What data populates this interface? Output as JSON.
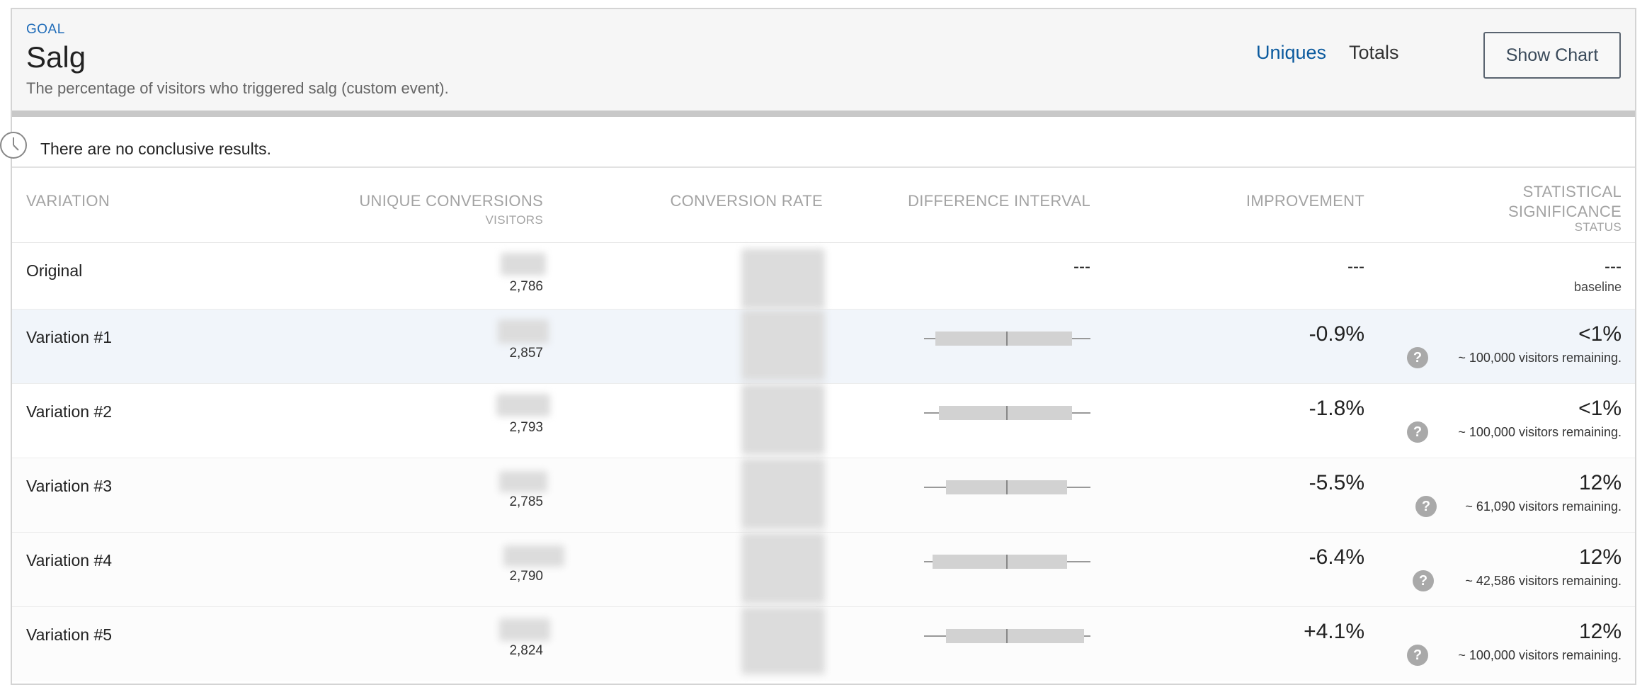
{
  "goal": {
    "label": "GOAL",
    "title": "Salg",
    "description": "The percentage of visitors who triggered salg (custom event)."
  },
  "tabs": {
    "uniques": "Uniques",
    "totals": "Totals",
    "active": "uniques"
  },
  "show_chart_label": "Show Chart",
  "notice": "There are no conclusive results.",
  "columns": {
    "variation": "VARIATION",
    "unique_conversions": "UNIQUE CONVERSIONS",
    "visitors": "VISITORS",
    "conversion_rate": "CONVERSION RATE",
    "difference_interval": "DIFFERENCE INTERVAL",
    "improvement": "IMPROVEMENT",
    "stat_sig_line1": "STATISTICAL",
    "stat_sig_line2": "SIGNIFICANCE",
    "status": "STATUS"
  },
  "rows": [
    {
      "name": "Original",
      "visitors": "2,786",
      "interval": "---",
      "improvement": "---",
      "significance": "---",
      "remaining": "baseline"
    },
    {
      "name": "Variation #1",
      "visitors": "2,857",
      "improvement": "-0.9%",
      "significance": "<1%",
      "remaining": "~ 100,000 visitors remaining.",
      "interval_range": [
        0.07,
        0.89
      ]
    },
    {
      "name": "Variation #2",
      "visitors": "2,793",
      "improvement": "-1.8%",
      "significance": "<1%",
      "remaining": "~ 100,000 visitors remaining.",
      "interval_range": [
        0.09,
        0.89
      ]
    },
    {
      "name": "Variation #3",
      "visitors": "2,785",
      "improvement": "-5.5%",
      "significance": "12%",
      "remaining": "~ 61,090 visitors remaining.",
      "interval_range": [
        0.13,
        0.86
      ]
    },
    {
      "name": "Variation #4",
      "visitors": "2,790",
      "improvement": "-6.4%",
      "significance": "12%",
      "remaining": "~ 42,586 visitors remaining.",
      "interval_range": [
        0.05,
        0.86
      ]
    },
    {
      "name": "Variation #5",
      "visitors": "2,824",
      "improvement": "+4.1%",
      "significance": "12%",
      "remaining": "~ 100,000 visitors remaining.",
      "interval_range": [
        0.13,
        0.96
      ]
    }
  ],
  "colors": {
    "accent": "#0b5a9e",
    "goal_label": "#1e6bb8",
    "highlight_row": "#f1f5fa"
  },
  "icons": {
    "notice": "clock-icon",
    "help": "help-icon"
  },
  "help_glyph": "?"
}
